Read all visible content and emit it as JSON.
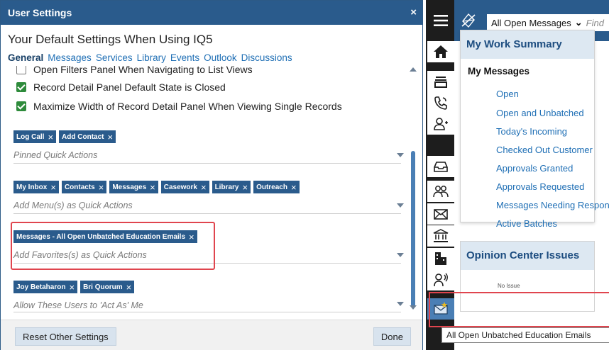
{
  "dialog": {
    "title": "User Settings",
    "close_glyph": "×",
    "heading": "Your Default Settings When Using IQ5",
    "tabs": [
      "General",
      "Messages",
      "Services",
      "Library",
      "Events",
      "Outlook",
      "Discussions"
    ],
    "active_tab": "General",
    "checkboxes": [
      {
        "label": "Open Filters Panel When Navigating to List Views",
        "checked": false
      },
      {
        "label": "Record Detail Panel Default State is Closed",
        "checked": true
      },
      {
        "label": "Maximize Width of Record Detail Panel When Viewing Single Records",
        "checked": true
      }
    ],
    "fields": [
      {
        "chips": [
          "Log Call",
          "Add Contact"
        ],
        "placeholder": "Pinned Quick Actions"
      },
      {
        "chips": [
          "My Inbox",
          "Contacts",
          "Messages",
          "Casework",
          "Library",
          "Outreach"
        ],
        "placeholder": "Add Menu(s) as Quick Actions"
      },
      {
        "chips": [
          "Messages - All Open Unbatched Education Emails"
        ],
        "placeholder": "Add Favorites(s) as Quick Actions"
      },
      {
        "chips": [
          "Joy Betaharon",
          "Bri Quorum"
        ],
        "placeholder": "Allow These Users to 'Act As' Me"
      }
    ],
    "chip_remove_glyph": "×",
    "reset_label": "Reset Other Settings",
    "done_label": "Done"
  },
  "app": {
    "selector_label": "All Open Messages",
    "selector_caret": "⌄",
    "find_placeholder": "Find",
    "work_summary": {
      "title": "My Work Summary",
      "section": "My Messages",
      "links": [
        "Open",
        "Open and Unbatched",
        "Today's Incoming",
        "Checked Out Customer",
        "Approvals Granted",
        "Approvals Requested",
        "Messages Needing Response",
        "Active Batches"
      ]
    },
    "opinion_title": "Opinion Center Issues",
    "opinion_row_label": "No Issue",
    "tooltip": "All Open Unbatched Education Emails",
    "rail_icons": [
      "menu-icon",
      "home-icon",
      "stack-icon",
      "phone-icon",
      "add-user-icon",
      "inbox-icon",
      "people-icon",
      "mail-icon",
      "institution-icon",
      "building-icon",
      "speaking-person-icon",
      "favorite-mail-icon"
    ]
  },
  "colors": {
    "brand_blue": "#2a5b8c",
    "link_blue": "#1f6fb5",
    "check_green": "#2e8b3b",
    "highlight_red": "#e0454e",
    "rail_dark": "#1d1d1d"
  }
}
